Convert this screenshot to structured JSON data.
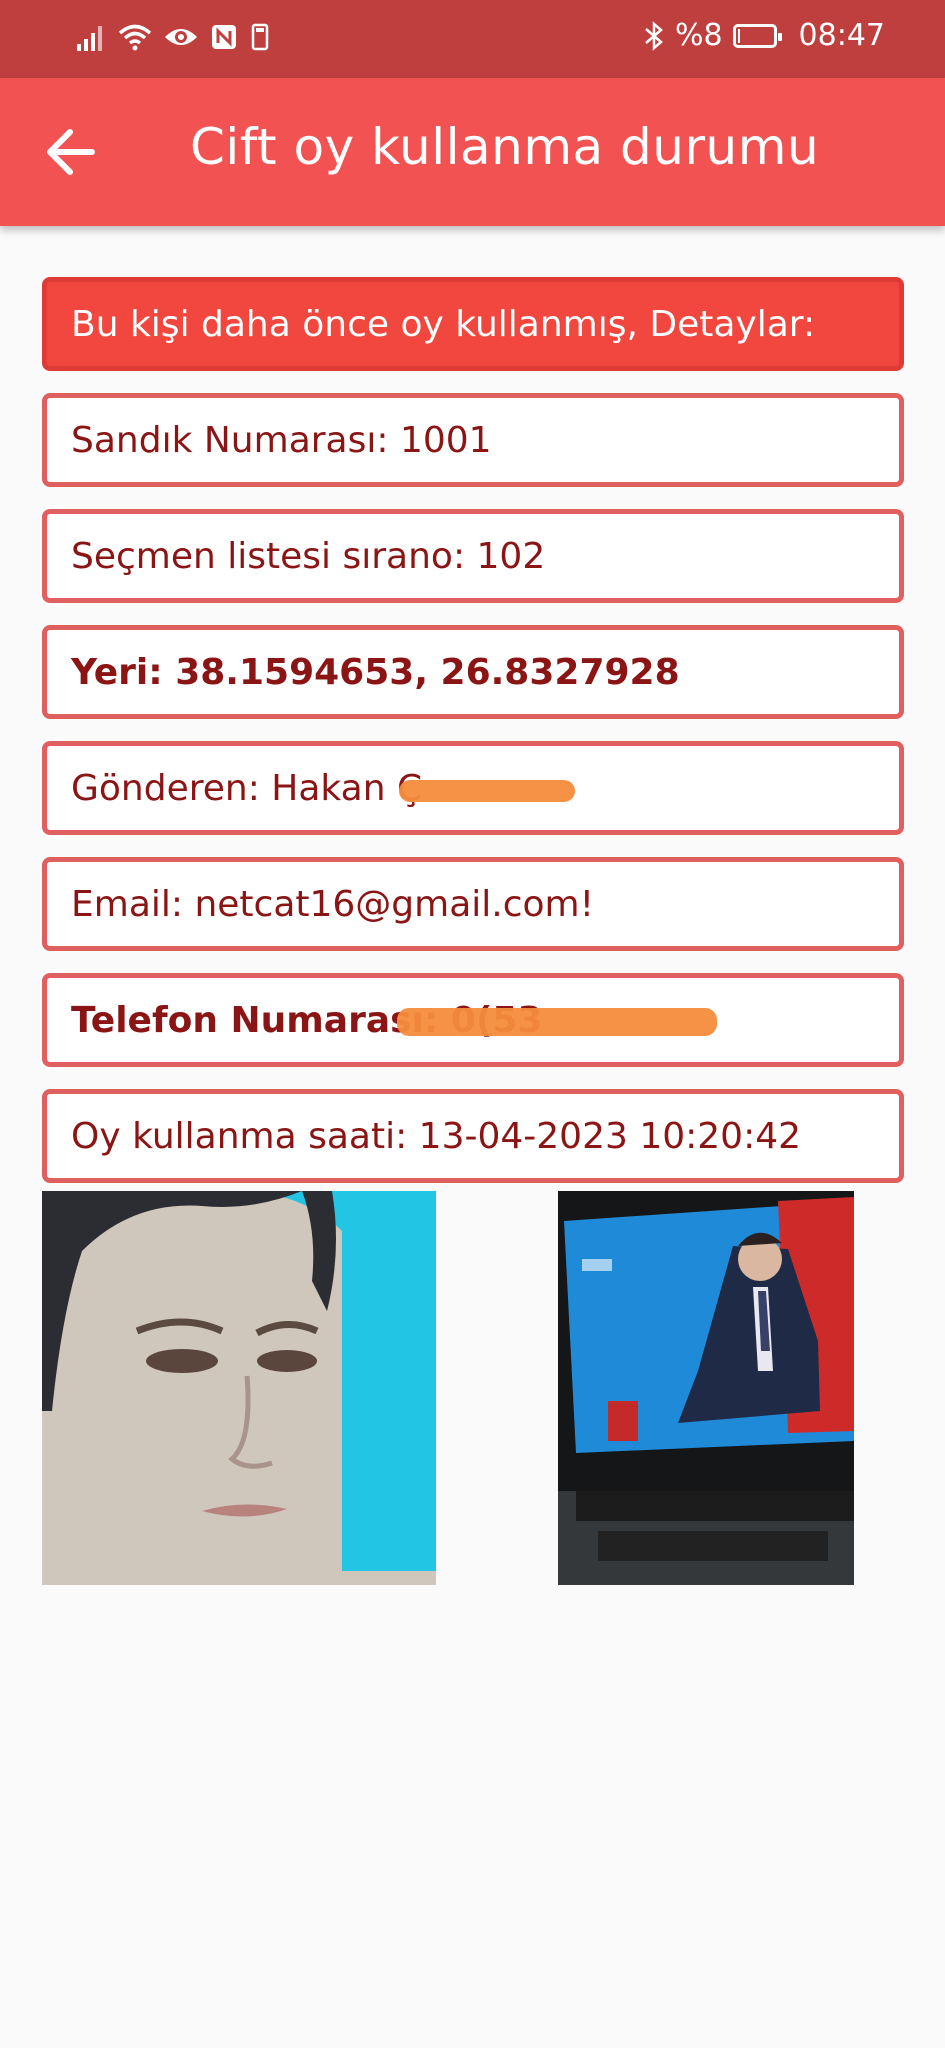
{
  "status_bar": {
    "battery_text": "%8",
    "time": "08:47",
    "icons": [
      "signal-icon",
      "wifi-icon",
      "eye-icon",
      "nfc-icon",
      "sim-icon",
      "bluetooth-icon",
      "battery-icon"
    ]
  },
  "app_bar": {
    "title": "Cift oy kullanma durumu",
    "back_icon": "back-arrow-icon"
  },
  "details": {
    "header": "Bu kişi daha önce oy kullanmış, Detaylar:",
    "ballot_box": "Sandık Numarası: 1001",
    "voter_list": "Seçmen listesi sırano: 102",
    "location": "Yeri: 38.1594653, 26.8327928",
    "sender": "Gönderen: Hakan Ç",
    "email": "Email: netcat16@gmail.com!",
    "phone": "Telefon Numarası: 0(53",
    "vote_time": "Oy kullanma saati: 13-04-2023 10:20:42"
  },
  "colors": {
    "status_bar": "#bf3f3f",
    "app_bar": "#f35252",
    "header_box": "#f2473f",
    "border": "#e06060",
    "text": "#8b1414",
    "redaction": "#f68c3c"
  }
}
